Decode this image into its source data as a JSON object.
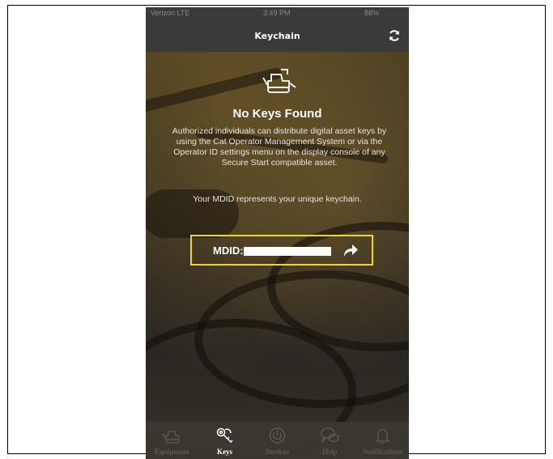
{
  "status_bar": {
    "carrier": "Verizon  LTE",
    "time": "3:49 PM",
    "battery": "88%"
  },
  "nav": {
    "title": "Keychain",
    "refresh_icon": "refresh-icon"
  },
  "empty_state": {
    "icon": "bulldozer-icon",
    "heading": "No Keys Found",
    "description": "Authorized individuals can distribute digital asset keys by using the Cat Operator Management System or via the Operator ID settings menu on the display console of any Secure Start compatible asset.",
    "note": "Your MDID represents your unique keychain."
  },
  "mdid": {
    "label": "MDID:",
    "value": "",
    "share_icon": "share-arrow-icon",
    "highlight_color": "#f3d22a"
  },
  "tabs": [
    {
      "label": "Equipment",
      "icon": "equipment-icon",
      "active": false
    },
    {
      "label": "Keys",
      "icon": "keys-icon",
      "active": true
    },
    {
      "label": "Devices",
      "icon": "power-icon",
      "active": false
    },
    {
      "label": "Help",
      "icon": "help-chat-icon",
      "active": false
    },
    {
      "label": "Notifications",
      "icon": "bell-icon",
      "active": false
    }
  ]
}
